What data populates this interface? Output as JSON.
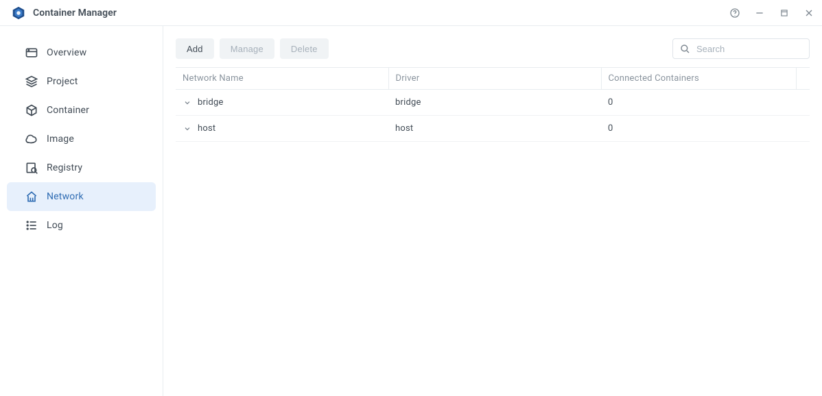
{
  "header": {
    "title": "Container Manager"
  },
  "sidebar": {
    "items": [
      {
        "label": "Overview",
        "icon": "overview-icon"
      },
      {
        "label": "Project",
        "icon": "project-icon"
      },
      {
        "label": "Container",
        "icon": "container-icon"
      },
      {
        "label": "Image",
        "icon": "image-icon"
      },
      {
        "label": "Registry",
        "icon": "registry-icon"
      },
      {
        "label": "Network",
        "icon": "network-icon"
      },
      {
        "label": "Log",
        "icon": "log-icon"
      }
    ],
    "active": "Network"
  },
  "toolbar": {
    "add_label": "Add",
    "manage_label": "Manage",
    "delete_label": "Delete"
  },
  "search": {
    "placeholder": "Search"
  },
  "table": {
    "columns": {
      "name": "Network Name",
      "driver": "Driver",
      "connected": "Connected Containers"
    },
    "rows": [
      {
        "name": "bridge",
        "driver": "bridge",
        "connected": "0"
      },
      {
        "name": "host",
        "driver": "host",
        "connected": "0"
      }
    ]
  }
}
